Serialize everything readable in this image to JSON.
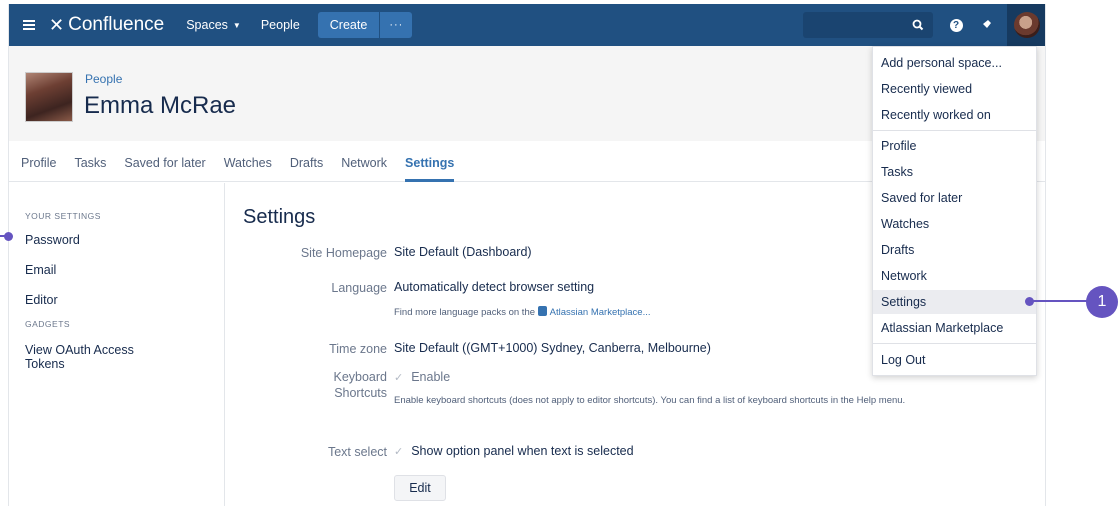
{
  "nav": {
    "app_name": "Confluence",
    "spaces_label": "Spaces",
    "people_label": "People",
    "create_label": "Create",
    "more_label": "···"
  },
  "profile": {
    "breadcrumb": "People",
    "name": "Emma McRae"
  },
  "tabs": [
    "Profile",
    "Tasks",
    "Saved for later",
    "Watches",
    "Drafts",
    "Network",
    "Settings"
  ],
  "active_tab": "Settings",
  "sidebar": {
    "your_settings_heading": "YOUR SETTINGS",
    "items": [
      "Password",
      "Email",
      "Editor"
    ],
    "gadgets_heading": "GADGETS",
    "gadget_item": "View OAuth Access Tokens"
  },
  "main": {
    "title": "Settings",
    "site_homepage_label": "Site Homepage",
    "site_homepage_value": "Site Default (Dashboard)",
    "language_label": "Language",
    "language_value": "Automatically detect browser setting",
    "language_help_prefix": "Find more language packs on the",
    "language_help_link": "Atlassian Marketplace...",
    "timezone_label": "Time zone",
    "timezone_value": "Site Default ((GMT+1000) Sydney, Canberra, Melbourne)",
    "keyboard_label_line1": "Keyboard",
    "keyboard_label_line2": "Shortcuts",
    "keyboard_value": "Enable",
    "keyboard_help": "Enable keyboard shortcuts (does not apply to editor shortcuts). You can find a list of keyboard shortcuts in the Help menu.",
    "text_select_label": "Text select",
    "text_select_value": "Show option panel when text is selected",
    "edit_label": "Edit"
  },
  "user_menu": {
    "items": [
      "Add personal space...",
      "Recently viewed",
      "Recently worked on",
      "Profile",
      "Tasks",
      "Saved for later",
      "Watches",
      "Drafts",
      "Network",
      "Settings",
      "Atlassian Marketplace",
      "Log Out"
    ],
    "highlighted": "Settings"
  },
  "callout": {
    "number": "1"
  },
  "colors": {
    "nav_bg": "#205081",
    "link": "#3572b0",
    "callout": "#6554c0"
  }
}
